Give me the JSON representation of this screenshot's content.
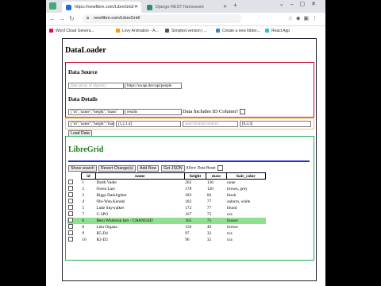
{
  "browser": {
    "tab_active": "https://newfibre.com/LibreGrid/",
    "tab_inactive": "Django REST framework",
    "url": "newfibre.com/LibreGrid/",
    "bookmarks": [
      "Word Cloud Genera...",
      "Levy Animation - A...",
      "Simplest version | ...",
      "Create a new folder...",
      "React App"
    ]
  },
  "dataloader": {
    "title": "DataLoader",
    "data_source_heading": "Data Source",
    "source_input_placeholder": "data (array of objects)",
    "source_url_value": "https://swapi.dev/api/people",
    "data_details_heading": "Data Details",
    "columns_value": "[\"id\",\"name\",\"height\",\"mass\"",
    "path_value": "results",
    "id_column_label": "Data Includes ID Column?",
    "options_columns_value": "[\"id\",\"name\",\"height\",\"mass\",",
    "options_widths_value": "[1,2,1,4]",
    "options_search_placeholder": "search(table|column)",
    "options_extra_value": "[0,2,3]",
    "load_button": "Load Data"
  },
  "libregrid": {
    "title": "LibreGrid",
    "buttons": {
      "show_search": "Show search",
      "revert": "Revert Change(s)",
      "add_row": "Add Row",
      "get_json": "Get JSON",
      "allow_reset": "Allow Data Reset"
    },
    "columns": [
      "id",
      "name",
      "height",
      "mass",
      "hair_color"
    ],
    "rows": [
      {
        "id": "1",
        "name": "Darth Vader",
        "height": "202",
        "mass": "136",
        "hair_color": "none"
      },
      {
        "id": "2",
        "name": "Owen Lars",
        "height": "178",
        "mass": "120",
        "hair_color": "brown, grey"
      },
      {
        "id": "3",
        "name": "Biggs Darklighter",
        "height": "183",
        "mass": "84",
        "hair_color": "black"
      },
      {
        "id": "4",
        "name": "Obi-Wan Kenobi",
        "height": "182",
        "mass": "77",
        "hair_color": "auburn, white"
      },
      {
        "id": "5",
        "name": "Luke Skywalker",
        "height": "172",
        "mass": "77",
        "hair_color": "blond"
      },
      {
        "id": "7",
        "name": "C-3PO",
        "height": "167",
        "mass": "75",
        "hair_color": "n/a"
      },
      {
        "id": "6",
        "name": "Beru Whitesun lars - CHANGED",
        "height": "165",
        "mass": "75",
        "hair_color": "brown"
      },
      {
        "id": "8",
        "name": "Leia Organa",
        "height": "150",
        "mass": "49",
        "hair_color": "brown"
      },
      {
        "id": "9",
        "name": "R5-D4",
        "height": "97",
        "mass": "32",
        "hair_color": "n/a"
      },
      {
        "id": "10",
        "name": "R2-D2",
        "height": "96",
        "mass": "32",
        "hair_color": "n/a"
      }
    ],
    "highlighted_row_id": "6"
  },
  "colors": {
    "dataloader_border": "#222233",
    "source_border": "#cc0033",
    "options_border": "#e5c66a",
    "libregrid_border": "#22aa55",
    "libregrid_title": "#1a7a1a",
    "libregrid_bar": "#1e35c7",
    "changed_row": "#8fe08f"
  }
}
